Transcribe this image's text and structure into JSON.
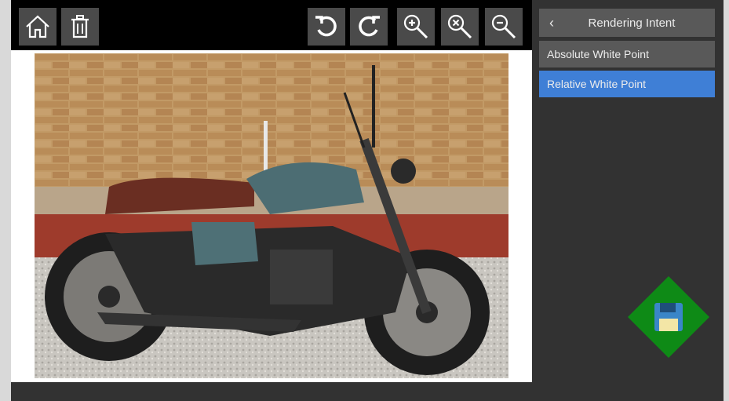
{
  "toolbar": {
    "buttons": [
      {
        "name": "home-button",
        "icon": "home-icon"
      },
      {
        "name": "delete-button",
        "icon": "trash-icon"
      },
      {
        "name": "rotate-left-button",
        "icon": "rotate-left-icon"
      },
      {
        "name": "rotate-right-button",
        "icon": "rotate-right-icon"
      },
      {
        "name": "zoom-in-button",
        "icon": "zoom-in-icon"
      },
      {
        "name": "zoom-reset-button",
        "icon": "zoom-reset-icon"
      },
      {
        "name": "zoom-out-button",
        "icon": "zoom-out-icon"
      }
    ]
  },
  "panel": {
    "back_icon": "‹",
    "title": "Rendering Intent",
    "options": [
      {
        "label": "Absolute White Point",
        "selected": false
      },
      {
        "label": "Relative White Point",
        "selected": true
      }
    ],
    "selected_color": "#3f7fd6"
  },
  "save_button": {
    "icon": "floppy-disk-icon",
    "color": "#0e8a16"
  }
}
